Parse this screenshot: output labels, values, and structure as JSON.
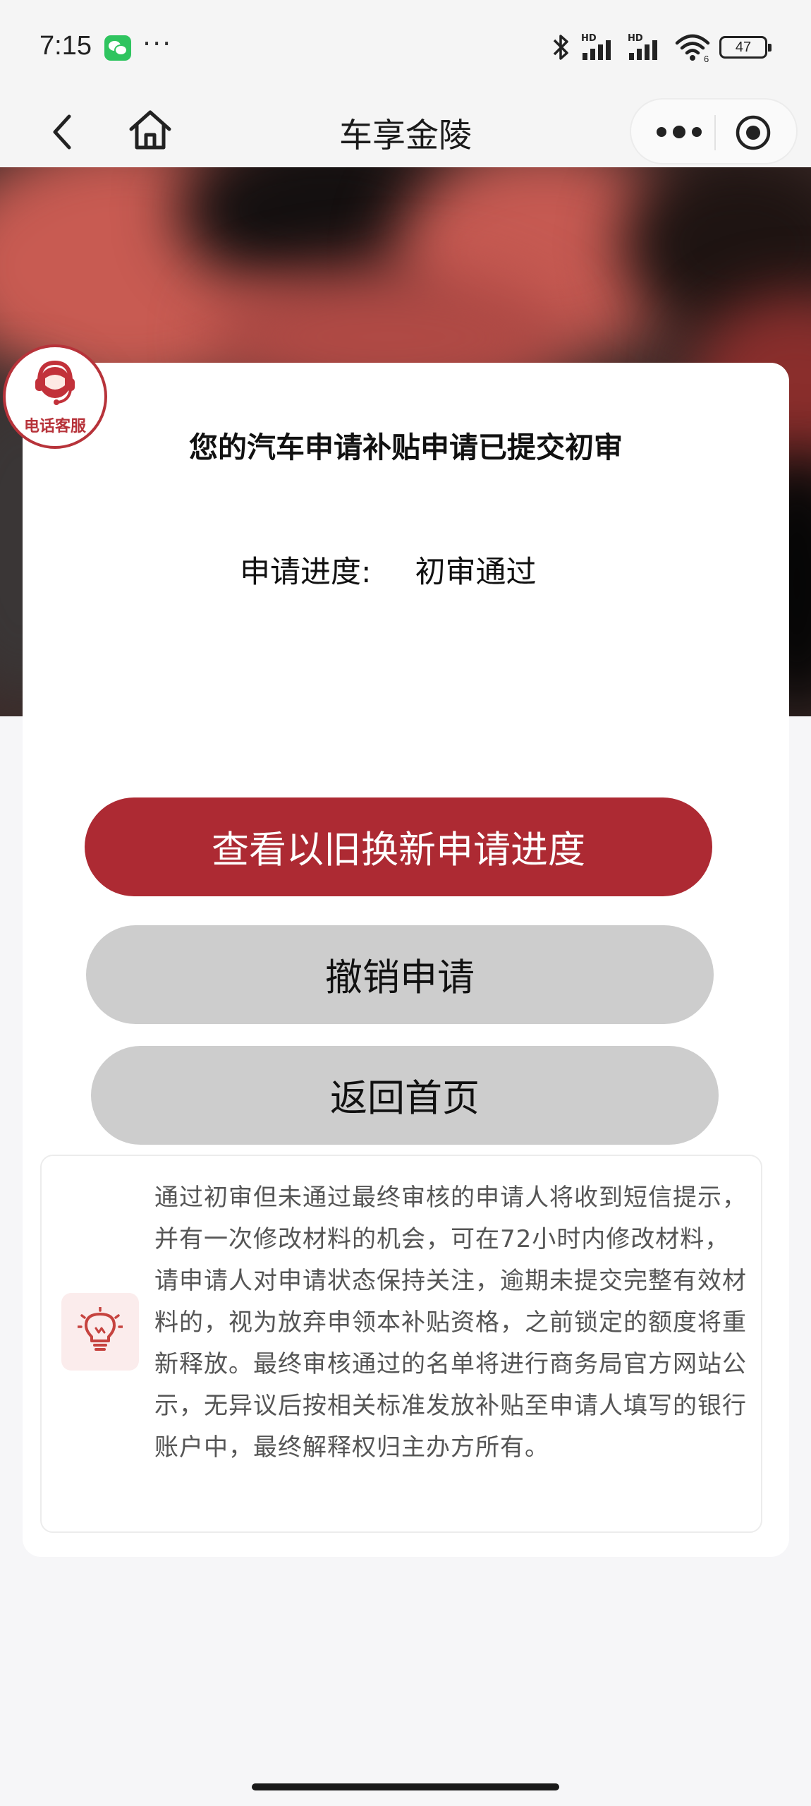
{
  "status_bar": {
    "time": "7:15",
    "dots": "···",
    "hd1": "HD",
    "hd2": "HD",
    "sim2_sub": "6",
    "battery": "47"
  },
  "nav": {
    "title": "车享金陵"
  },
  "service_badge": {
    "label": "电话客服"
  },
  "card": {
    "title": "您的汽车申请补贴申请已提交初审",
    "progress_label": "申请进度:",
    "progress_value": "初审通过"
  },
  "buttons": {
    "primary": "查看以旧换新申请进度",
    "revoke": "撤销申请",
    "home": "返回首页"
  },
  "notice": {
    "text": "通过初审但未通过最终审核的申请人将收到短信提示，并有一次修改材料的机会，可在72小时内修改材料，请申请人对申请状态保持关注，逾期未提交完整有效材料的，视为放弃申领本补贴资格，之前锁定的额度将重新释放。最终审核通过的名单将进行商务局官方网站公示，无异议后按相关标准发放补贴至申请人填写的银行账户中，最终解释权归主办方所有。"
  },
  "icons": {
    "back": "chevron-left-icon",
    "home": "home-icon",
    "more": "more-dots-icon",
    "close": "target-close-icon",
    "service": "headset-agent-icon",
    "notice": "lightbulb-icon"
  },
  "colors": {
    "primary": "#ad2a33",
    "secondary_button": "#cdcdcd",
    "wechat": "#2fc45f"
  }
}
